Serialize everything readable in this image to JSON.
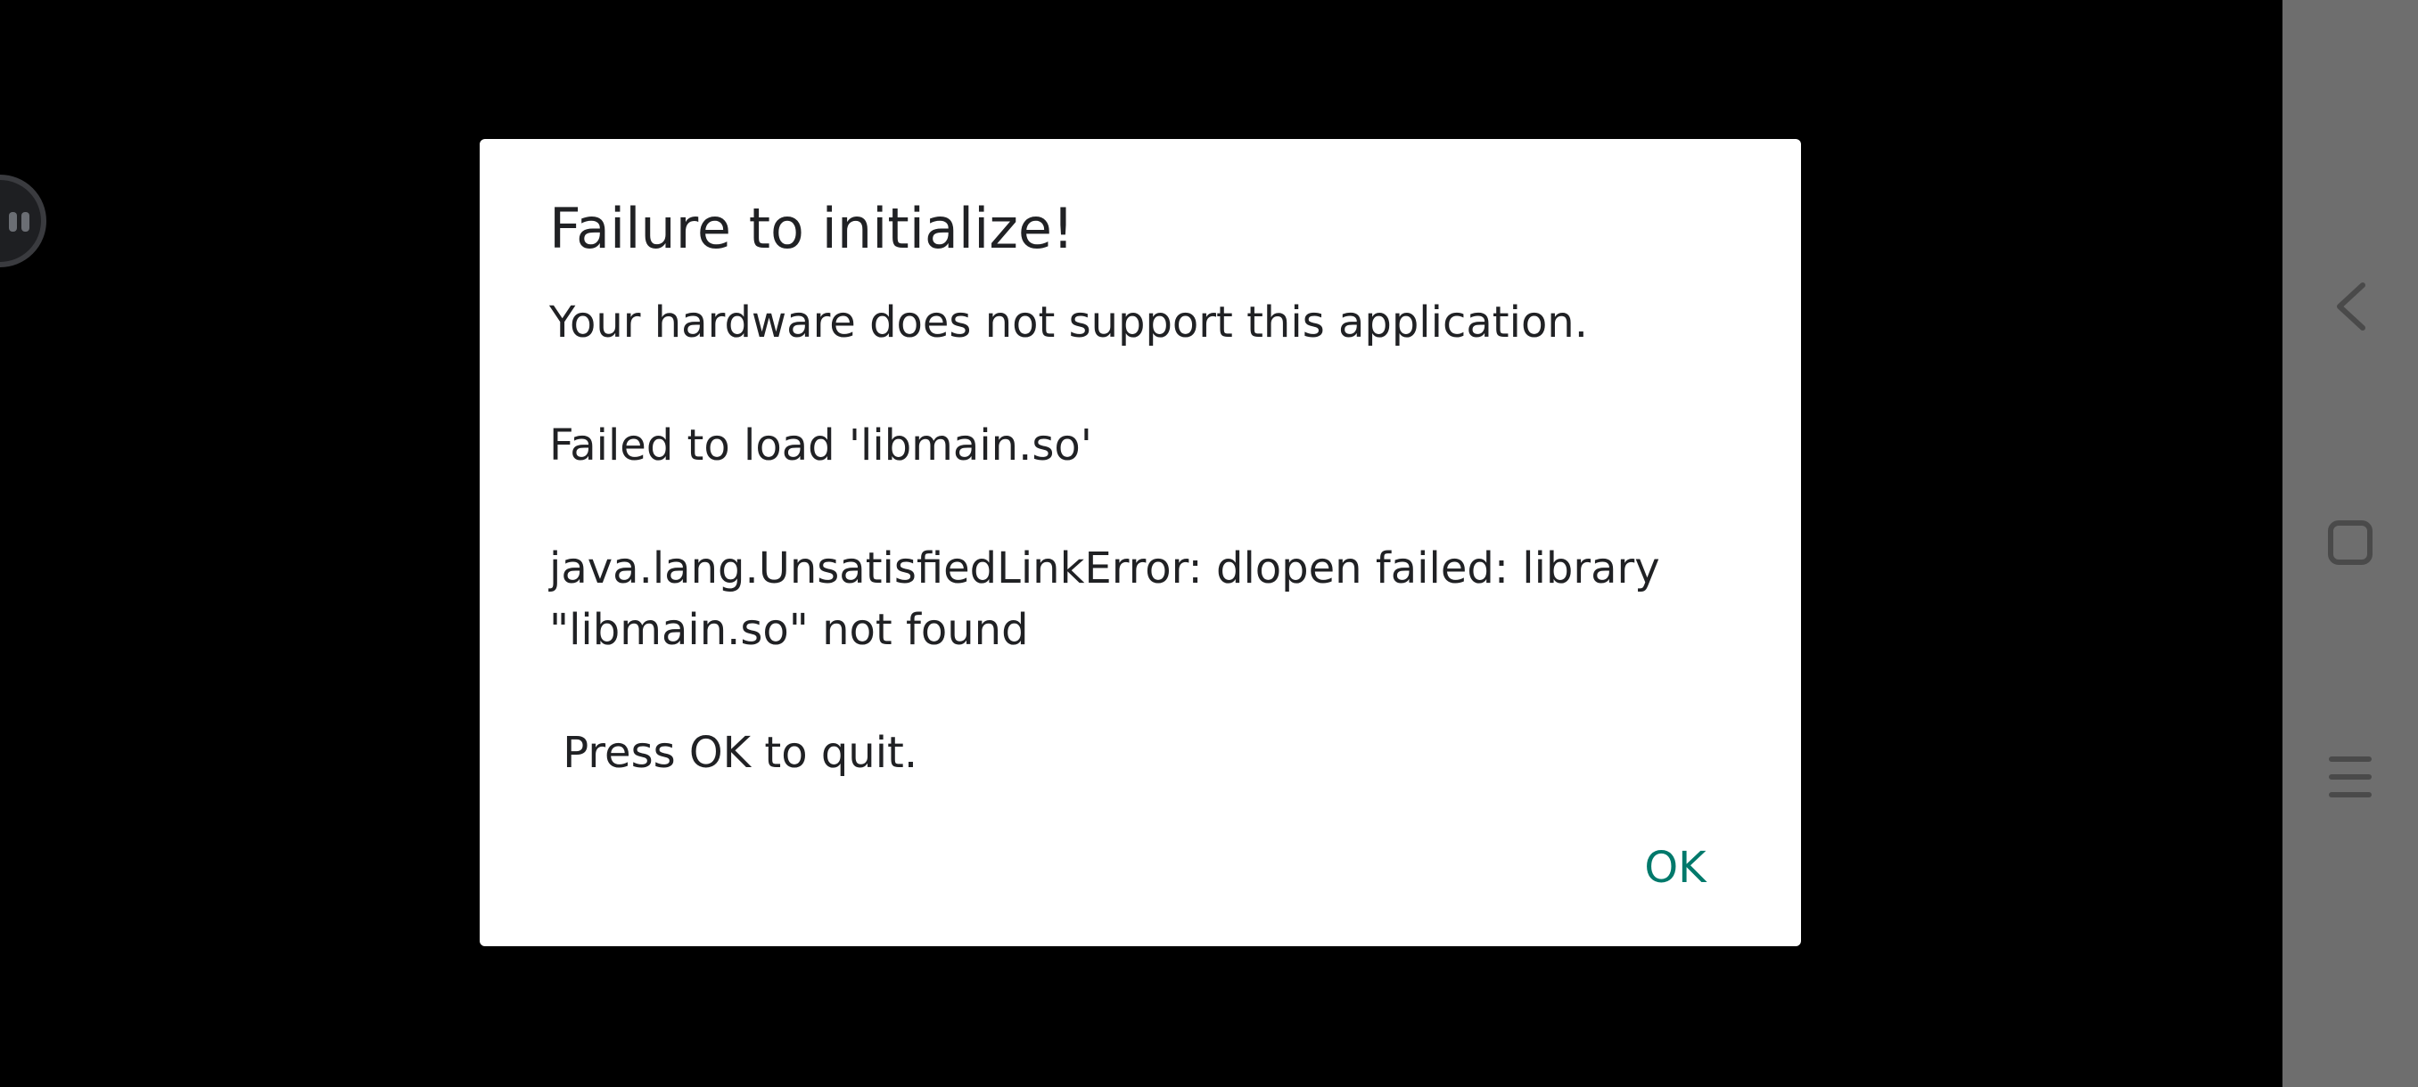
{
  "dialog": {
    "title": "Failure to initialize!",
    "message": "Your hardware does not support this application.\n\nFailed to load 'libmain.so'\n\njava.lang.UnsatisfiedLinkError: dlopen failed: library \"libmain.so\" not found\n\n Press OK to quit.",
    "ok_label": "OK",
    "accent_color": "#00796b"
  },
  "floating_ball": {
    "icon": "floating-assistant-icon"
  },
  "navigation_bar": {
    "buttons": [
      {
        "icon": "back-icon"
      },
      {
        "icon": "home-icon"
      },
      {
        "icon": "recents-icon"
      }
    ],
    "background_color": "#6e6e6e"
  }
}
